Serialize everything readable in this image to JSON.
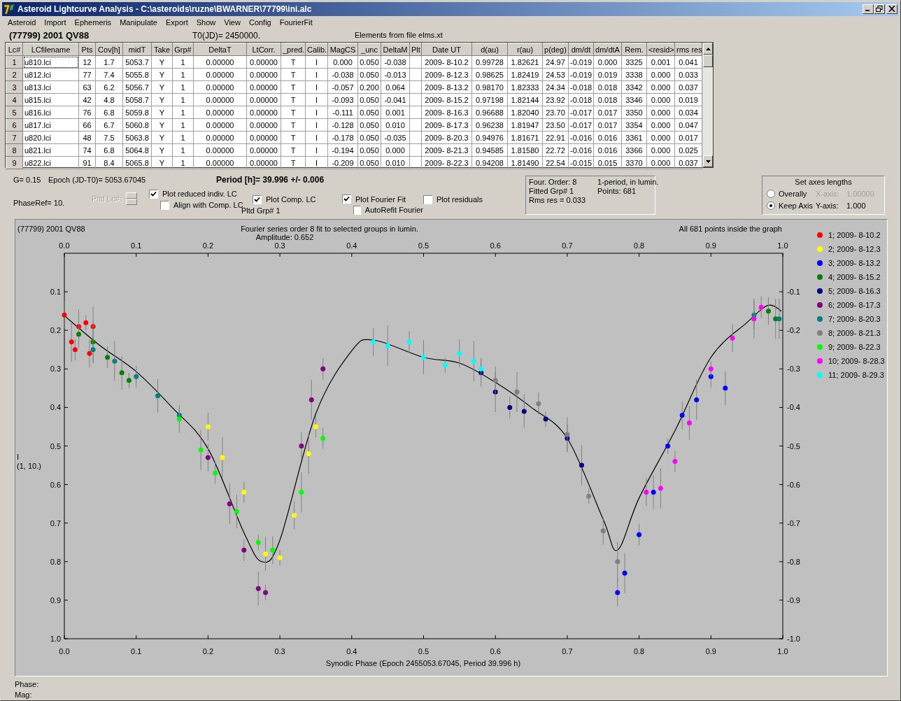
{
  "window": {
    "title": "Asteroid Lightcurve Analysis - C:\\asteroids\\ruzne\\BWARNER\\77799\\ini.alc"
  },
  "menu": [
    "Asteroid",
    "Import",
    "Ephemeris",
    "Manipulate",
    "Export",
    "Show",
    "View",
    "Config",
    "FourierFit"
  ],
  "info": {
    "asteroid": "(77799) 2001 QV88",
    "t0": "T0(JD)= 2450000.",
    "elements": "Elements from file elms.xt"
  },
  "table": {
    "columns": [
      "Lc#",
      "LCfilename",
      "Pts",
      "Cov[h]",
      "midT",
      "Take",
      "Grp#",
      "DeltaT",
      "LtCorr.",
      "_pred.",
      "Calib.",
      "MagCS",
      "_unc",
      "DeltaM",
      "Plt",
      "Date UT",
      "d(au)",
      "r(au)",
      "p(deg)",
      "dm/dt",
      "dm/dtA",
      "Rem.",
      "<resid>",
      "rms res"
    ],
    "rows": [
      [
        "1",
        "u810.lci",
        "12",
        "1.7",
        "5053.7",
        "Y",
        "1",
        "0.00000",
        "0.00000",
        "T",
        "I",
        "0.000",
        "0.050",
        "-0.038",
        "",
        "2009- 8-10.2",
        "0.99728",
        "1.82621",
        "24.97",
        "-0.019",
        "0.000",
        "3325",
        "0.001",
        "0.041"
      ],
      [
        "2",
        "u812.lci",
        "77",
        "7.4",
        "5055.8",
        "Y",
        "1",
        "0.00000",
        "0.00000",
        "T",
        "I",
        "-0.038",
        "0.050",
        "-0.013",
        "",
        "2009- 8-12.3",
        "0.98625",
        "1.82419",
        "24.53",
        "-0.019",
        "0.019",
        "3338",
        "0.000",
        "0.033"
      ],
      [
        "3",
        "u813.lci",
        "63",
        "6.2",
        "5056.7",
        "Y",
        "1",
        "0.00000",
        "0.00000",
        "T",
        "I",
        "-0.057",
        "0.200",
        "0.064",
        "",
        "2009- 8-13.2",
        "0.98170",
        "1.82333",
        "24.34",
        "-0.018",
        "0.018",
        "3342",
        "0.000",
        "0.037"
      ],
      [
        "4",
        "u815.lci",
        "42",
        "4.8",
        "5058.7",
        "Y",
        "1",
        "0.00000",
        "0.00000",
        "T",
        "I",
        "-0.093",
        "0.050",
        "-0.041",
        "",
        "2009- 8-15.2",
        "0.97198",
        "1.82144",
        "23.92",
        "-0.018",
        "0.018",
        "3346",
        "0.000",
        "0.019"
      ],
      [
        "5",
        "u816.lci",
        "76",
        "6.8",
        "5059.8",
        "Y",
        "1",
        "0.00000",
        "0.00000",
        "T",
        "I",
        "-0.111",
        "0.050",
        "0.001",
        "",
        "2009- 8-16.3",
        "0.96688",
        "1.82040",
        "23.70",
        "-0.017",
        "0.017",
        "3350",
        "0.000",
        "0.034"
      ],
      [
        "6",
        "u817.lci",
        "66",
        "6.7",
        "5060.8",
        "Y",
        "1",
        "0.00000",
        "0.00000",
        "T",
        "I",
        "-0.128",
        "0.050",
        "0.010",
        "",
        "2009- 8-17.3",
        "0.96238",
        "1.81947",
        "23.50",
        "-0.017",
        "0.017",
        "3354",
        "0.000",
        "0.047"
      ],
      [
        "7",
        "u820.lci",
        "48",
        "7.5",
        "5063.8",
        "Y",
        "1",
        "0.00000",
        "0.00000",
        "T",
        "I",
        "-0.178",
        "0.050",
        "-0.035",
        "",
        "2009- 8-20.3",
        "0.94976",
        "1.81671",
        "22.91",
        "-0.016",
        "0.016",
        "3361",
        "0.000",
        "0.017"
      ],
      [
        "8",
        "u821.lci",
        "74",
        "6.8",
        "5064.8",
        "Y",
        "1",
        "0.00000",
        "0.00000",
        "T",
        "I",
        "-0.194",
        "0.050",
        "0.000",
        "",
        "2009- 8-21.3",
        "0.94585",
        "1.81580",
        "22.72",
        "-0.016",
        "0.016",
        "3366",
        "0.000",
        "0.025"
      ],
      [
        "9",
        "u822.lci",
        "91",
        "8.4",
        "5065.8",
        "Y",
        "1",
        "0.00000",
        "0.00000",
        "T",
        "I",
        "-0.209",
        "0.050",
        "0.010",
        "",
        "2009- 8-22.3",
        "0.94208",
        "1.81490",
        "22.54",
        "-0.015",
        "0.015",
        "3370",
        "0.000",
        "0.037"
      ]
    ]
  },
  "controls": {
    "g": "G= 0.15",
    "epoch": "Epoch (JD-T0)= 5053.67045",
    "period": "Period [h]= 39.996 +/- 0.006",
    "phase_ref": "PhaseRef= 10.",
    "pltd_lc": {
      "label": "Pltd Lc#:",
      "disabled": true
    },
    "pltd_grp": "Pltd Grp#  1",
    "checkboxes": [
      {
        "label": "Plot reduced indiv. LC",
        "checked": true
      },
      {
        "label": "Align with Comp. LC",
        "checked": false
      },
      {
        "label": "Plot Comp. LC",
        "checked": true
      },
      {
        "label": "Plot Fourier Fit",
        "checked": true
      },
      {
        "label": "AutoRefit Fourier",
        "checked": false
      },
      {
        "label": "Plot residuals",
        "checked": false
      }
    ]
  },
  "fit_info": [
    "Four. Order:  8",
    "1-period, in lumin.",
    "Fitted Grp# 1",
    "Points: 681",
    "Rms res      = 0.033"
  ],
  "axes_lengths": {
    "title": "Set axes lengths",
    "options": [
      {
        "label": "Overally",
        "selected": false,
        "axis_label": "X-axis:",
        "axis_value": "1.00000",
        "disabled": true
      },
      {
        "label": "Keep Axis",
        "selected": true,
        "axis_label": "Y-axis:",
        "axis_value": "1.000",
        "disabled": false
      }
    ]
  },
  "plot": {
    "subtitle": "Fourier series order 8 fit to selected groups in lumin.",
    "amplitude": "Amplitude: 0.652",
    "note": "All 681 points inside the graph",
    "ylabel_extra": "(1, 10.)",
    "top_tick_labels": [
      "0.0",
      "0.1",
      "0.2",
      "0.3",
      "0.4",
      "0.5",
      "0.6",
      "0.7",
      "0.8",
      "0.9",
      "1.0"
    ],
    "right_tick_labels": [
      "-0.1",
      "-0.2",
      "-0.3",
      "-0.4",
      "-0.5",
      "-0.6",
      "-0.7",
      "-0.8",
      "-0.9",
      "-1.0"
    ],
    "chart_data": {
      "type": "scatter",
      "title": "(77799) 2001 QV88",
      "xlabel": "Synodic Phase (Epoch 2455053.67045, Period 39.996 h)",
      "ylabel": "I",
      "xlim": [
        0,
        1
      ],
      "ylim": [
        1.0,
        0.0
      ],
      "xticks": [
        {
          "value": 0,
          "label": "0.0"
        },
        {
          "value": 0.1,
          "label": "0.1"
        },
        {
          "value": 0.2,
          "label": "0.2"
        },
        {
          "value": 0.3,
          "label": "0.3"
        },
        {
          "value": 0.4,
          "label": "0.4"
        },
        {
          "value": 0.5,
          "label": "0.5"
        },
        {
          "value": 0.6,
          "label": "0.6"
        },
        {
          "value": 0.7,
          "label": "0.7"
        },
        {
          "value": 0.8,
          "label": "0.8"
        },
        {
          "value": 0.9,
          "label": "0.9"
        },
        {
          "value": 1,
          "label": "1.0"
        }
      ],
      "yticks": [
        {
          "value": 0.1,
          "label": "0.1"
        },
        {
          "value": 0.2,
          "label": "0.2"
        },
        {
          "value": 0.3,
          "label": "0.3"
        },
        {
          "value": 0.4,
          "label": "0.4"
        },
        {
          "value": 0.5,
          "label": "0.5"
        },
        {
          "value": 0.6,
          "label": "0.6"
        },
        {
          "value": 0.7,
          "label": "0.7"
        },
        {
          "value": 0.8,
          "label": "0.8"
        },
        {
          "value": 0.9,
          "label": "0.9"
        },
        {
          "value": 1,
          "label": "1.0"
        }
      ],
      "series": [
        {
          "name": "1; 2009- 8-10.2",
          "color": "#ff0000",
          "x": [
            0.0,
            0.01,
            0.015,
            0.02,
            0.03,
            0.035,
            0.04
          ],
          "values": [
            0.16,
            0.23,
            0.25,
            0.19,
            0.18,
            0.26,
            0.19
          ],
          "errors": [
            0.036,
            0.052,
            0.028,
            0.044,
            0.02,
            0.036,
            0.052
          ]
        },
        {
          "name": "2; 2009- 8-12.3",
          "color": "#ffff00",
          "x": [
            0.2,
            0.22,
            0.25,
            0.28,
            0.3,
            0.32,
            0.34,
            0.35
          ],
          "values": [
            0.45,
            0.53,
            0.62,
            0.78,
            0.79,
            0.68,
            0.52,
            0.45
          ],
          "errors": [
            0.036,
            0.052,
            0.028,
            0.044,
            0.02,
            0.036,
            0.052,
            0.028
          ]
        },
        {
          "name": "3; 2009- 8-13.2",
          "color": "#0000ff",
          "x": [
            0.77,
            0.78,
            0.8,
            0.82,
            0.84,
            0.86,
            0.88,
            0.9,
            0.92
          ],
          "values": [
            0.88,
            0.83,
            0.73,
            0.62,
            0.5,
            0.42,
            0.38,
            0.32,
            0.35
          ],
          "errors": [
            0.036,
            0.052,
            0.028,
            0.044,
            0.02,
            0.036,
            0.052,
            0.028,
            0.044
          ]
        },
        {
          "name": "4; 2009- 8-15.2",
          "color": "#008000",
          "x": [
            0.02,
            0.04,
            0.06,
            0.08,
            0.09,
            0.98,
            0.99
          ],
          "values": [
            0.21,
            0.23,
            0.27,
            0.31,
            0.33,
            0.15,
            0.17
          ],
          "errors": [
            0.036,
            0.052,
            0.028,
            0.044,
            0.02,
            0.036,
            0.052
          ]
        },
        {
          "name": "5; 2009- 8-16.3",
          "color": "#000080",
          "x": [
            0.58,
            0.6,
            0.62,
            0.64,
            0.67,
            0.7,
            0.72
          ],
          "values": [
            0.31,
            0.36,
            0.4,
            0.41,
            0.43,
            0.48,
            0.55
          ],
          "errors": [
            0.036,
            0.052,
            0.028,
            0.044,
            0.02,
            0.036,
            0.052
          ]
        },
        {
          "name": "6; 2009- 8-17.3",
          "color": "#800080",
          "x": [
            0.2,
            0.23,
            0.25,
            0.27,
            0.28,
            0.33,
            0.344,
            0.36
          ],
          "values": [
            0.53,
            0.65,
            0.77,
            0.87,
            0.88,
            0.5,
            0.38,
            0.3
          ],
          "errors": [
            0.036,
            0.052,
            0.028,
            0.044,
            0.02,
            0.036,
            0.052,
            0.028
          ]
        },
        {
          "name": "7; 2009- 8-20.3",
          "color": "#008080",
          "x": [
            0.04,
            0.07,
            0.1,
            0.13,
            0.16,
            0.96,
            0.995
          ],
          "values": [
            0.25,
            0.28,
            0.32,
            0.37,
            0.42,
            0.16,
            0.17
          ],
          "errors": [
            0.036,
            0.052,
            0.028,
            0.044,
            0.02,
            0.036,
            0.052
          ]
        },
        {
          "name": "8; 2009- 8-21.3",
          "color": "#808080",
          "x": [
            0.6,
            0.63,
            0.66,
            0.7,
            0.73,
            0.75,
            0.77
          ],
          "values": [
            0.33,
            0.36,
            0.39,
            0.47,
            0.63,
            0.72,
            0.8
          ],
          "errors": [
            0.036,
            0.052,
            0.028,
            0.044,
            0.02,
            0.036,
            0.052
          ]
        },
        {
          "name": "9; 2009- 8-22.3",
          "color": "#00ff00",
          "x": [
            0.16,
            0.19,
            0.21,
            0.24,
            0.27,
            0.29,
            0.33,
            0.36
          ],
          "values": [
            0.43,
            0.51,
            0.57,
            0.67,
            0.75,
            0.77,
            0.62,
            0.48
          ],
          "errors": [
            0.036,
            0.052,
            0.028,
            0.044,
            0.02,
            0.036,
            0.052,
            0.028
          ]
        },
        {
          "name": "10; 2009- 8-28.3",
          "color": "#ff00ff",
          "x": [
            0.81,
            0.83,
            0.85,
            0.87,
            0.9,
            0.93,
            0.96,
            0.97
          ],
          "values": [
            0.62,
            0.61,
            0.54,
            0.44,
            0.3,
            0.22,
            0.17,
            0.14
          ],
          "errors": [
            0.036,
            0.052,
            0.028,
            0.044,
            0.02,
            0.036,
            0.052,
            0.028
          ]
        },
        {
          "name": "11; 2009- 8-29.3",
          "color": "#00ffff",
          "x": [
            0.43,
            0.45,
            0.48,
            0.5,
            0.53,
            0.55,
            0.57,
            0.58
          ],
          "values": [
            0.23,
            0.24,
            0.23,
            0.27,
            0.29,
            0.26,
            0.28,
            0.3
          ],
          "errors": [
            0.036,
            0.052,
            0.028,
            0.044,
            0.02,
            0.036,
            0.052,
            0.028
          ]
        },
        {
          "type": "line",
          "color": "#000000",
          "x": [
            0,
            0.05,
            0.1,
            0.15,
            0.2,
            0.25,
            0.275,
            0.3,
            0.35,
            0.4,
            0.43,
            0.5,
            0.55,
            0.6,
            0.65,
            0.7,
            0.75,
            0.77,
            0.8,
            0.85,
            0.9,
            0.95,
            0.98,
            1.0
          ],
          "values": [
            0.162,
            0.24,
            0.307,
            0.4,
            0.507,
            0.725,
            0.8,
            0.744,
            0.416,
            0.253,
            0.225,
            0.27,
            0.285,
            0.335,
            0.4,
            0.48,
            0.69,
            0.77,
            0.635,
            0.46,
            0.27,
            0.18,
            0.135,
            0.153
          ]
        }
      ]
    }
  },
  "status": [
    "Phase:",
    "Mag:"
  ]
}
